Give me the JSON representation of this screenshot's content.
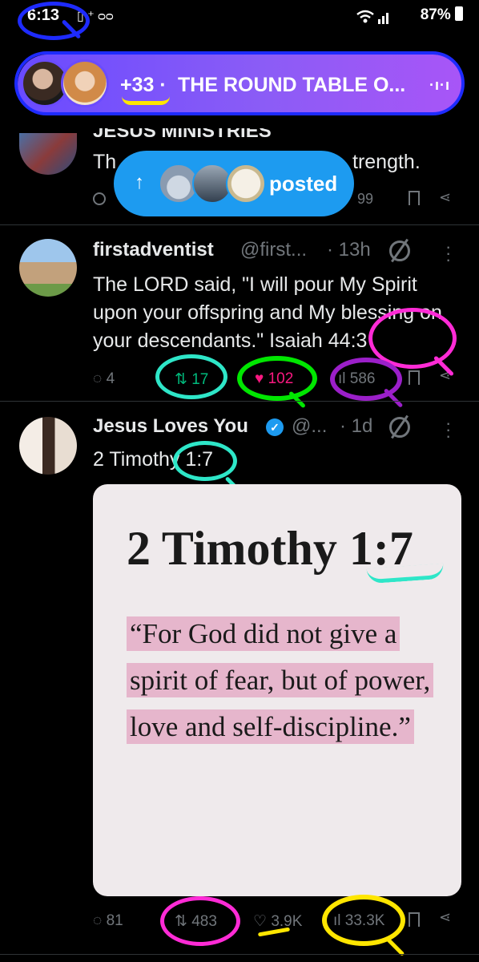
{
  "status_bar": {
    "time": "6:13",
    "left_icons": "▯ ⁺ ᴑᴑ",
    "right": "87%",
    "signal_icons": "wifi-signal"
  },
  "spaces": {
    "count": "+33 ·",
    "title": "THE ROUND TABLE O...",
    "bars": "·ı·ı"
  },
  "prev_tweet": {
    "header_cut": "JESUS MINISTRIES",
    "text_left": "Th",
    "text_right": "trength.",
    "views": "99"
  },
  "posted_pill": {
    "arrow": "↑",
    "label": "posted"
  },
  "tweet1": {
    "name": "firstadventist",
    "handle": "@first...",
    "time": "· 13h",
    "text": "The LORD said, \"I will pour My Spirit upon your offspring and My blessing on your descendants.\" Isaiah 44:3",
    "replies": "4",
    "reposts": "17",
    "likes": "102",
    "views": "586",
    "repost_color": "#00ba7c",
    "like_color": "#f91880"
  },
  "tweet2": {
    "name": "Jesus Loves You",
    "handle": "@...",
    "time": "· 1d",
    "text": "2 Timothy 1:7",
    "card_title": "2 Timothy 1:7",
    "card_quote": "“For God did not give a spirit of fear, but of power, love and self-discipline.”",
    "replies": "81",
    "reposts": "483",
    "likes": "3.9K",
    "views": "33.3K"
  },
  "colors": {
    "accent": "#1d9bf0",
    "ring_blue": "#1e2bff",
    "ring_cyan": "#2ee6c8",
    "ring_green": "#00e600",
    "ring_purple": "#9b1fc9",
    "ring_magenta": "#ff2bd6",
    "ring_yellow": "#ffe600"
  }
}
